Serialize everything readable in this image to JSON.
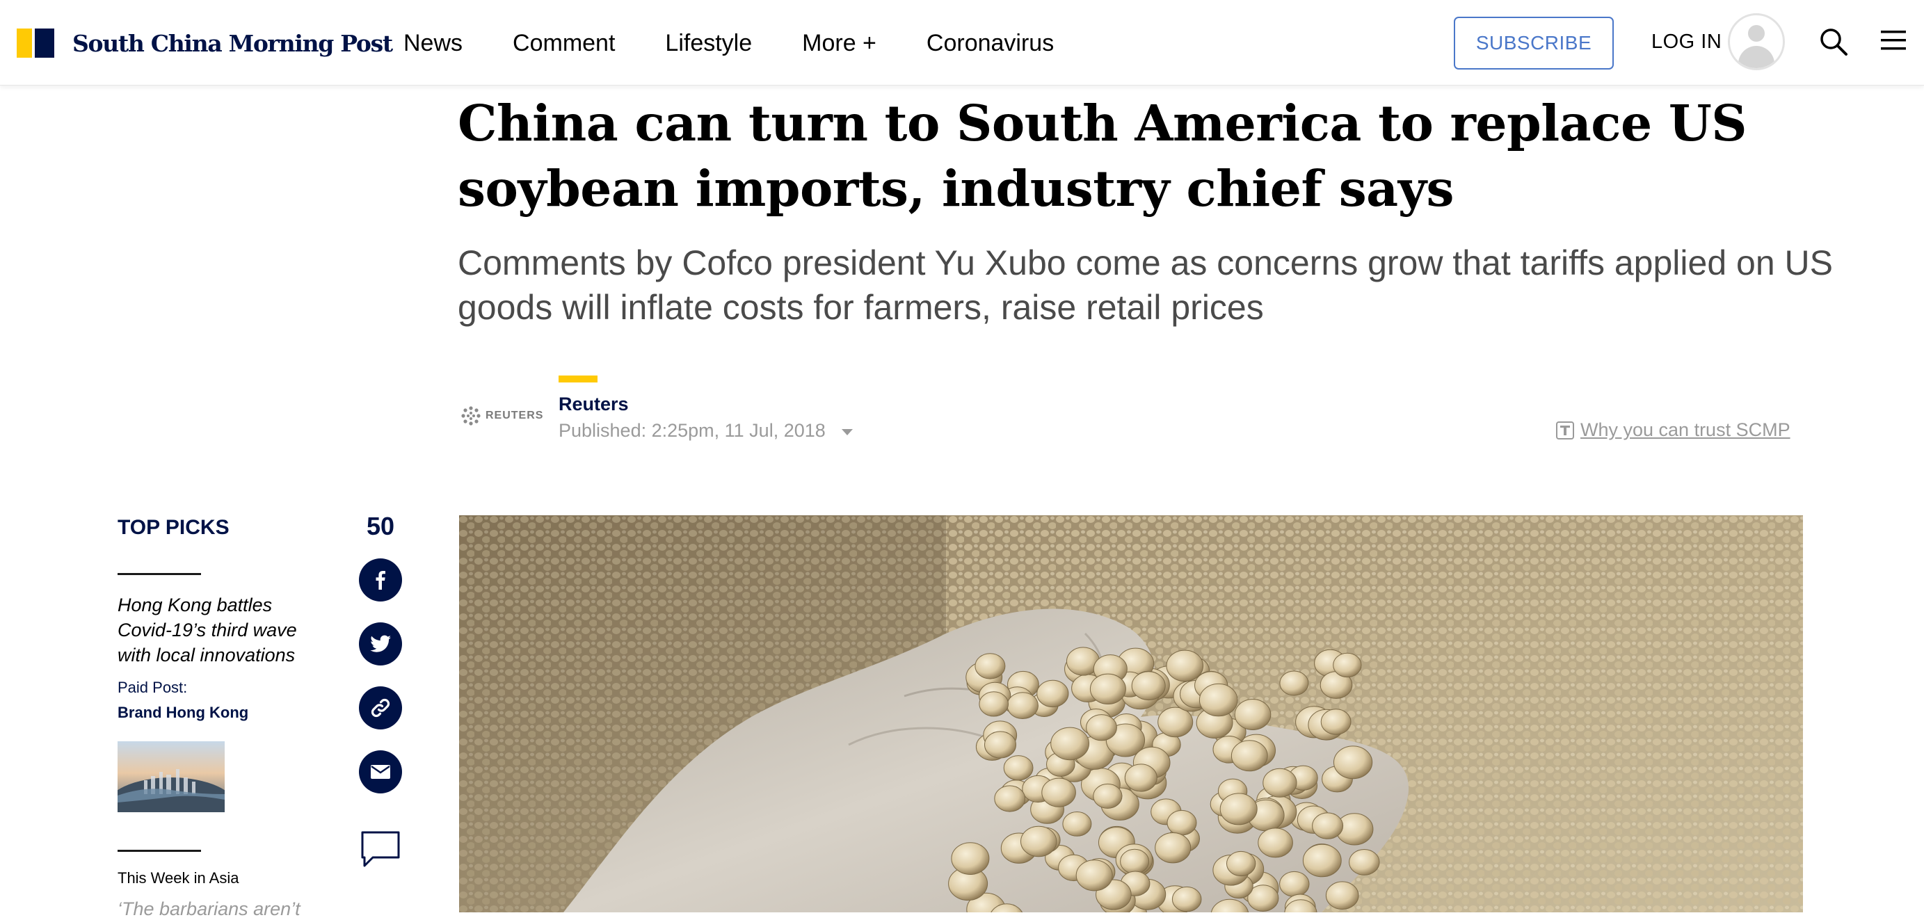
{
  "header": {
    "logo_text": "South China Morning Post",
    "nav": [
      "News",
      "Comment",
      "Lifestyle",
      "More +",
      "Coronavirus"
    ],
    "subscribe_label": "SUBSCRIBE",
    "login_label": "LOG IN"
  },
  "article": {
    "headline": "China can turn to South America to replace US soybean imports, industry chief says",
    "subhead": "Comments by Cofco president Yu Xubo come as concerns grow that tariffs applied on US goods will inflate costs for farmers, raise retail prices",
    "source_logo_text": "REUTERS",
    "author": "Reuters",
    "published": "Published: 2:25pm, 11 Jul, 2018",
    "trust_link": "Why you can trust SCMP"
  },
  "sidebar": {
    "top_picks_label": "TOP PICKS",
    "pick_title": "Hong Kong battles Covid-19’s third wave with local innovations",
    "paid_label": "Paid Post:",
    "paid_brand": "Brand Hong Kong",
    "week_label": "This Week in Asia",
    "week_title": "‘The barbarians aren’t"
  },
  "share": {
    "count": "50"
  },
  "colors": {
    "brand_navy": "#001246",
    "brand_yellow": "#FFCA05",
    "subscribe_blue": "#4A77C9",
    "muted_gray": "#9a9a9a"
  },
  "icons": [
    "search-icon",
    "menu-icon",
    "avatar-icon",
    "facebook-icon",
    "twitter-icon",
    "link-icon",
    "email-icon",
    "comment-icon",
    "trust-icon",
    "caret-down-icon"
  ]
}
